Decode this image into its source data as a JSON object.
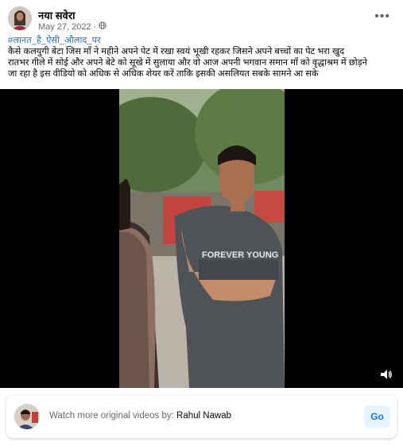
{
  "post": {
    "page_name": "नया सवेरा",
    "date": "May 27, 2022",
    "privacy_icon": "globe-icon",
    "more_icon": "more-horizontal-icon",
    "hashtag": "#लानत_है_ऐसी_औलाद_पर",
    "caption_lines": [
      "कैसे कलयुगी बेटा जिस माँ ने महीने अपने पेट में रखा  स्वयं भूखी रहकर जिसने अपने बच्चों का पेट भरा खुद",
      "रातभर गीले में सोई और अपने बेटे को सूखे में सुलाया और वो आज अपनी भगवान समान माँ को वृद्धाश्रम में छोड़ने",
      "जा रहा है इस वीडियो को अधिक से अधिक शेयर करें ताकि इसकी असलियत सबके सामने आ सके"
    ]
  },
  "video": {
    "shirt_text": "FOREVER YOUNG",
    "volume_icon": "volume-icon"
  },
  "promo": {
    "prefix": "Watch more original videos by: ",
    "author": "Rahul Nawab",
    "go_label": "Go"
  },
  "colors": {
    "link": "#216fdb",
    "button_bg": "#e7f3ff",
    "button_text": "#1877f2"
  }
}
